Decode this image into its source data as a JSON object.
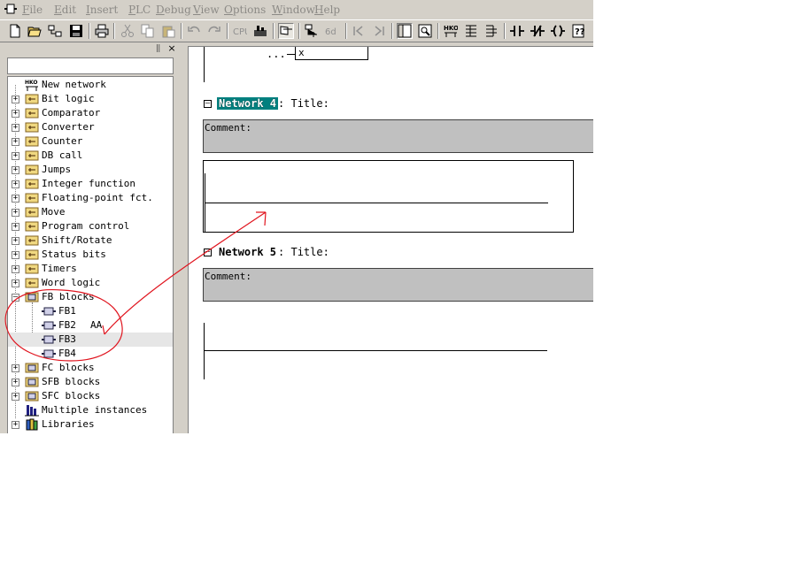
{
  "menu": {
    "items": [
      {
        "label": "File",
        "ul": "F"
      },
      {
        "label": "Edit",
        "ul": "E"
      },
      {
        "label": "Insert",
        "ul": "I"
      },
      {
        "label": "PLC",
        "ul": "P"
      },
      {
        "label": "Debug",
        "ul": "D"
      },
      {
        "label": "View",
        "ul": "V"
      },
      {
        "label": "Options",
        "ul": "O"
      },
      {
        "label": "Window",
        "ul": "W"
      },
      {
        "label": "Help",
        "ul": "H"
      }
    ]
  },
  "toolbar": {
    "buttons": [
      "new-icon",
      "open-icon",
      "accessible-nodes-icon",
      "save-icon",
      "print-icon",
      "cut-icon",
      "copy-icon",
      "paste-icon",
      "undo-icon",
      "redo-icon",
      "download-icon",
      "monitor-icon",
      "program-elements-icon",
      "network-icon",
      "branch-icon",
      "previous-network-icon",
      "next-network-icon",
      "overview-icon",
      "zoom-icon",
      "new-network-icon",
      "open-branch-icon",
      "close-branch-icon",
      "normally-open-contact-icon",
      "normally-closed-contact-icon",
      "coil-icon",
      "empty-box-icon"
    ]
  },
  "tree": {
    "items": [
      {
        "label": "New network",
        "icon": "new-network-icon",
        "level": 0,
        "expander": "none"
      },
      {
        "label": "Bit logic",
        "icon": "bit-logic-icon",
        "level": 0,
        "expander": "+"
      },
      {
        "label": "Comparator",
        "icon": "comparator-icon",
        "level": 0,
        "expander": "+"
      },
      {
        "label": "Converter",
        "icon": "converter-icon",
        "level": 0,
        "expander": "+"
      },
      {
        "label": "Counter",
        "icon": "counter-icon",
        "level": 0,
        "expander": "+"
      },
      {
        "label": "DB call",
        "icon": "db-call-icon",
        "level": 0,
        "expander": "+"
      },
      {
        "label": "Jumps",
        "icon": "jumps-icon",
        "level": 0,
        "expander": "+"
      },
      {
        "label": "Integer function",
        "icon": "integer-function-icon",
        "level": 0,
        "expander": "+"
      },
      {
        "label": "Floating-point fct.",
        "icon": "floating-point-icon",
        "level": 0,
        "expander": "+"
      },
      {
        "label": "Move",
        "icon": "move-icon",
        "level": 0,
        "expander": "+"
      },
      {
        "label": "Program control",
        "icon": "program-control-icon",
        "level": 0,
        "expander": "+"
      },
      {
        "label": "Shift/Rotate",
        "icon": "shift-rotate-icon",
        "level": 0,
        "expander": "+"
      },
      {
        "label": "Status bits",
        "icon": "status-bits-icon",
        "level": 0,
        "expander": "+"
      },
      {
        "label": "Timers",
        "icon": "timers-icon",
        "level": 0,
        "expander": "+"
      },
      {
        "label": "Word logic",
        "icon": "word-logic-icon",
        "level": 0,
        "expander": "+"
      },
      {
        "label": "FB blocks",
        "icon": "fb-blocks-icon",
        "level": 0,
        "expander": "-"
      },
      {
        "label": "FB1",
        "icon": "fb-icon",
        "level": 1,
        "expander": "none",
        "extra": ""
      },
      {
        "label": "FB2",
        "icon": "fb-icon",
        "level": 1,
        "expander": "none",
        "extra": "AA"
      },
      {
        "label": "FB3",
        "icon": "fb-icon",
        "level": 1,
        "expander": "none",
        "extra": "",
        "selected": true
      },
      {
        "label": "FB4",
        "icon": "fb-icon",
        "level": 1,
        "expander": "none",
        "extra": ""
      },
      {
        "label": "FC blocks",
        "icon": "fc-blocks-icon",
        "level": 0,
        "expander": "+"
      },
      {
        "label": "SFB blocks",
        "icon": "sfb-blocks-icon",
        "level": 0,
        "expander": "+"
      },
      {
        "label": "SFC blocks",
        "icon": "sfc-blocks-icon",
        "level": 0,
        "expander": "+"
      },
      {
        "label": "Multiple instances",
        "icon": "multiple-instances-icon",
        "level": 0,
        "expander": "none"
      },
      {
        "label": "Libraries",
        "icon": "libraries-icon",
        "level": 0,
        "expander": "+"
      }
    ]
  },
  "editor": {
    "top_fragment": {
      "dots": "...",
      "operand": "x"
    },
    "networks": [
      {
        "name": "Network 4",
        "title_label": ": Title:",
        "comment_label": "Comment:",
        "selected": true
      },
      {
        "name": "Network 5",
        "title_label": ": Title:",
        "comment_label": "Comment:",
        "selected": false
      }
    ]
  },
  "colors": {
    "chrome": "#d4d0c8",
    "selection": "#00807f",
    "comment_bg": "#c0c0c0",
    "annotation": "#e0141e"
  }
}
